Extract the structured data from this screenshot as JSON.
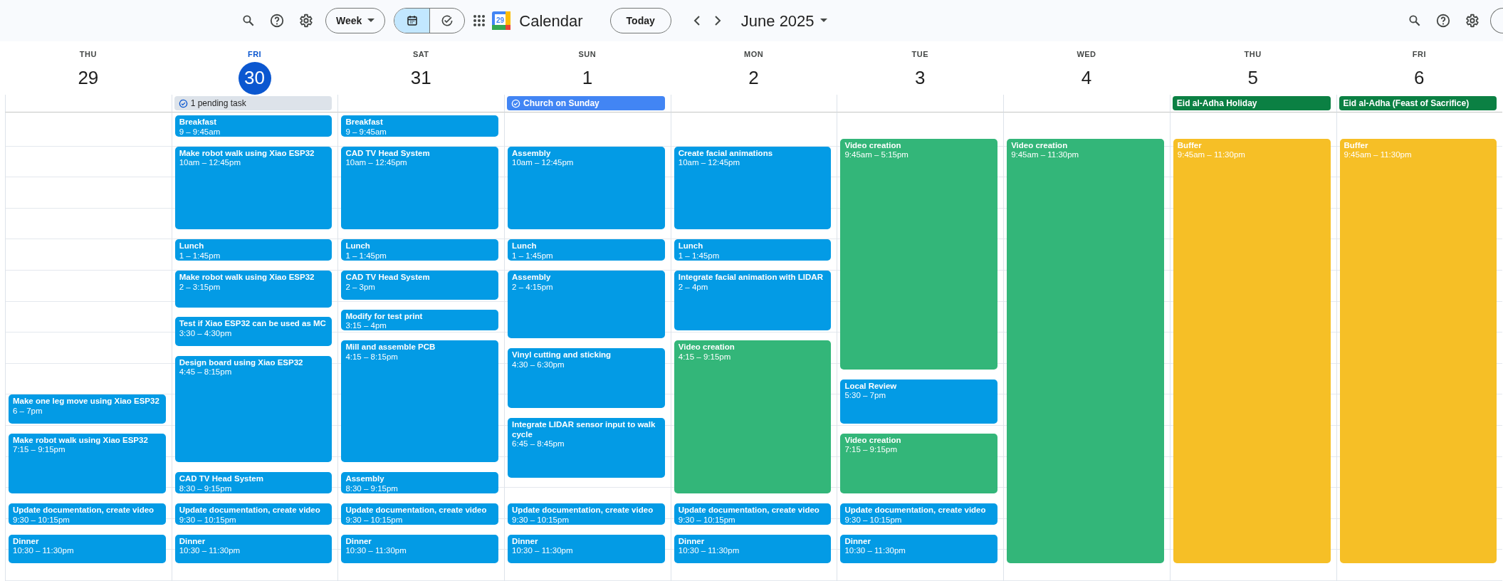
{
  "toolbar_left": {
    "view_button": "Week",
    "view_toggle": [
      {
        "kind": "calendar",
        "selected": true
      },
      {
        "kind": "tasks",
        "selected": false
      }
    ],
    "logo_text": "29",
    "app_title": "Calendar",
    "today_button": "Today",
    "period": "June 2025"
  },
  "days": [
    {
      "weekday": "THU",
      "date": "29",
      "today": false,
      "events": [
        {
          "title": "Make one leg move using Xiao ESP32",
          "time": "6 – 7pm",
          "color": "#039be5"
        },
        {
          "title": "Make robot walk using Xiao ESP32",
          "time": "7:15 – 9:15pm",
          "color": "#039be5"
        },
        {
          "title": "Update documentation, create video",
          "time": "9:30 – 10:15pm",
          "color": "#039be5"
        },
        {
          "title": "Dinner",
          "time": "10:30 – 11:30pm",
          "color": "#039be5"
        }
      ]
    },
    {
      "weekday": "FRI",
      "date": "30",
      "today": true,
      "all_day": [
        {
          "kind": "task_summary",
          "label": "1 pending task",
          "color": "#dde3ea"
        }
      ],
      "events": [
        {
          "title": "Breakfast",
          "time": "9 – 9:45am",
          "color": "#039be5"
        },
        {
          "title": "Make robot walk using Xiao ESP32",
          "time": "10am – 12:45pm",
          "color": "#039be5"
        },
        {
          "title": "Lunch",
          "time": "1 – 1:45pm",
          "color": "#039be5"
        },
        {
          "title": "Make robot walk using Xiao ESP32",
          "time": "2 – 3:15pm",
          "color": "#039be5"
        },
        {
          "title": "Test if Xiao ESP32 can be used as MC",
          "time": "3:30 – 4:30pm",
          "color": "#039be5"
        },
        {
          "title": "Design board using Xiao ESP32",
          "time": "4:45 – 8:15pm",
          "color": "#039be5"
        },
        {
          "title": "CAD TV Head System",
          "time": "8:30 – 9:15pm",
          "color": "#039be5"
        },
        {
          "title": "Update documentation, create video",
          "time": "9:30 – 10:15pm",
          "color": "#039be5"
        },
        {
          "title": "Dinner",
          "time": "10:30 – 11:30pm",
          "color": "#039be5"
        }
      ]
    },
    {
      "weekday": "SAT",
      "date": "31",
      "today": false,
      "events": [
        {
          "title": "Breakfast",
          "time": "9 – 9:45am",
          "color": "#039be5"
        },
        {
          "title": "CAD TV Head System",
          "time": "10am – 12:45pm",
          "color": "#039be5"
        },
        {
          "title": "Lunch",
          "time": "1 – 1:45pm",
          "color": "#039be5"
        },
        {
          "title": "CAD TV Head System",
          "time": "2 – 3pm",
          "color": "#039be5"
        },
        {
          "title": "Modify for test print",
          "time": "3:15 – 4pm",
          "color": "#039be5"
        },
        {
          "title": "Mill and assemble PCB",
          "time": "4:15 – 8:15pm",
          "color": "#039be5"
        },
        {
          "title": "Assembly",
          "time": "8:30 – 9:15pm",
          "color": "#039be5"
        },
        {
          "title": "Update documentation, create video",
          "time": "9:30 – 10:15pm",
          "color": "#039be5"
        },
        {
          "title": "Dinner",
          "time": "10:30 – 11:30pm",
          "color": "#039be5"
        }
      ]
    },
    {
      "weekday": "SUN",
      "date": "1",
      "today": false,
      "all_day": [
        {
          "kind": "task",
          "label": "Church on Sunday",
          "color": "#4285f4"
        }
      ],
      "events": [
        {
          "title": "Assembly",
          "time": "10am – 12:45pm",
          "color": "#039be5"
        },
        {
          "title": "Lunch",
          "time": "1 – 1:45pm",
          "color": "#039be5"
        },
        {
          "title": "Assembly",
          "time": "2 – 4:15pm",
          "color": "#039be5"
        },
        {
          "title": "Vinyl cutting and sticking",
          "time": "4:30 – 6:30pm",
          "color": "#039be5"
        },
        {
          "title": "Integrate LIDAR sensor input to walk cycle",
          "time": "6:45 – 8:45pm",
          "color": "#039be5"
        },
        {
          "title": "Update documentation, create video",
          "time": "9:30 – 10:15pm",
          "color": "#039be5"
        },
        {
          "title": "Dinner",
          "time": "10:30 – 11:30pm",
          "color": "#039be5"
        }
      ]
    },
    {
      "weekday": "MON",
      "date": "2",
      "today": false,
      "events": [
        {
          "title": "Create facial animations",
          "time": "10am – 12:45pm",
          "color": "#039be5"
        },
        {
          "title": "Lunch",
          "time": "1 – 1:45pm",
          "color": "#039be5"
        },
        {
          "title": "Integrate facial animation with LIDAR",
          "time": "2 – 4pm",
          "color": "#039be5"
        },
        {
          "title": "Video creation",
          "time": "4:15 – 9:15pm",
          "color": "#33b679"
        },
        {
          "title": "Update documentation, create video",
          "time": "9:30 – 10:15pm",
          "color": "#039be5"
        },
        {
          "title": "Dinner",
          "time": "10:30 – 11:30pm",
          "color": "#039be5"
        }
      ]
    },
    {
      "weekday": "TUE",
      "date": "3",
      "today": false,
      "events": [
        {
          "title": "Video creation",
          "time": "9:45am – 5:15pm",
          "color": "#33b679"
        },
        {
          "title": "Local Review",
          "time": "5:30 – 7pm",
          "color": "#039be5"
        },
        {
          "title": "Video creation",
          "time": "7:15 – 9:15pm",
          "color": "#33b679"
        },
        {
          "title": "Update documentation, create video",
          "time": "9:30 – 10:15pm",
          "color": "#039be5"
        },
        {
          "title": "Dinner",
          "time": "10:30 – 11:30pm",
          "color": "#039be5"
        }
      ]
    },
    {
      "weekday": "WED",
      "date": "4",
      "today": false,
      "events": [
        {
          "title": "Video creation",
          "time": "9:45am – 11:30pm",
          "color": "#33b679"
        }
      ]
    },
    {
      "weekday": "THU",
      "date": "5",
      "today": false,
      "all_day": [
        {
          "kind": "event",
          "label": "Eid al-Adha Holiday",
          "color": "#0b8043"
        }
      ],
      "events": [
        {
          "title": "Buffer",
          "time": "9:45am – 11:30pm",
          "color": "#f6bf26"
        }
      ]
    },
    {
      "weekday": "FRI",
      "date": "6",
      "today": false,
      "all_day": [
        {
          "kind": "event",
          "label": "Eid al-Adha (Feast of Sacrifice)",
          "color": "#0b8043"
        }
      ],
      "events": [
        {
          "title": "Buffer",
          "time": "9:45am – 11:30pm",
          "color": "#f6bf26"
        }
      ]
    }
  ]
}
